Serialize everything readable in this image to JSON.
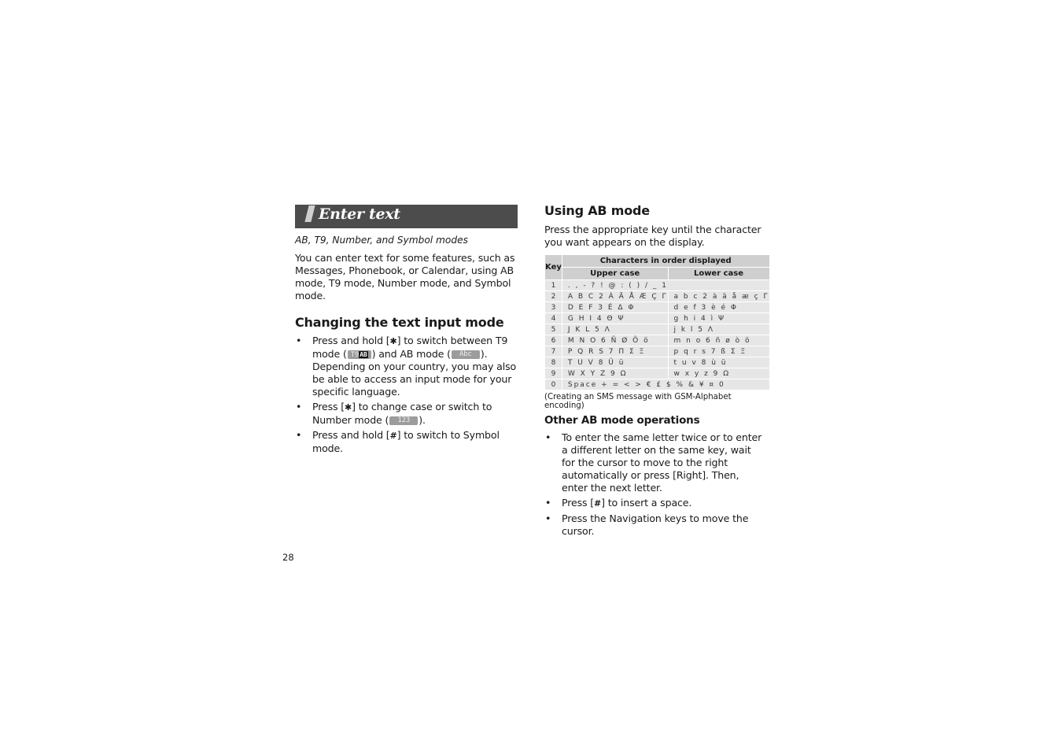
{
  "left": {
    "banner_title": "Enter text",
    "subtitle": "AB, T9, Number, and Symbol modes",
    "intro": "You can enter text for some features, such as Messages, Phonebook, or Calendar, using AB mode, T9 mode, Number mode, and Symbol mode.",
    "section_heading": "Changing the text input mode",
    "bullets": {
      "b1_part1": "Press and hold [",
      "b1_key": "✱",
      "b1_part2": "] to switch between T9 mode (",
      "b1_icon_t9": "T9",
      "b1_icon_t9_inv": "AB",
      "b1_part3": ") and AB mode (",
      "b1_icon_abc": "Abc",
      "b1_part4": "). Depending on your country, you may also be able to access an input mode for your specific language.",
      "b2_part1": "Press [",
      "b2_key": "✱",
      "b2_part2": "] to change case or switch to Number mode (",
      "b2_icon_123": "123",
      "b2_part3": ").",
      "b3_part1": "Press and hold [",
      "b3_key": "#",
      "b3_part2": "] to switch to Symbol mode."
    },
    "bullet_glyph": "•"
  },
  "right": {
    "heading": "Using AB mode",
    "intro": "Press the appropriate key until the character you want appears on the display.",
    "table": {
      "col_key": "Key",
      "col_group": "Characters in order displayed",
      "col_upper": "Upper case",
      "col_lower": "Lower case",
      "rows": [
        {
          "key": "1",
          "all": ". , - ? ! @ : ( ) / _ 1"
        },
        {
          "key": "2",
          "upper": "A B C 2 À Ä Å Æ Ç Γ",
          "lower": "a b c 2 à ä å æ ç Γ"
        },
        {
          "key": "3",
          "upper": "D E F 3 É Δ Φ",
          "lower": "d e f 3 è é Φ"
        },
        {
          "key": "4",
          "upper": "G H I 4 Θ Ψ",
          "lower": "g h i 4 ì Ψ"
        },
        {
          "key": "5",
          "upper": "J K L 5 Λ",
          "lower": "j k l 5 Λ"
        },
        {
          "key": "6",
          "upper": "M N O 6 Ñ Ø Ö ö",
          "lower": "m n o 6 ñ ø ò ö"
        },
        {
          "key": "7",
          "upper": "P Q R S 7 Π Σ Ξ",
          "lower": "p q r s 7 ß Σ Ξ"
        },
        {
          "key": "8",
          "upper": "T U V 8 Ü ü",
          "lower": "t u v 8 ù ü"
        },
        {
          "key": "9",
          "upper": "W X Y Z 9 Ω",
          "lower": "w x y z 9 Ω"
        },
        {
          "key": "0",
          "all": "Space + = < > € £ $ % & ¥ ¤ 0"
        }
      ]
    },
    "caption": "(Creating an SMS message with GSM-Alphabet encoding)",
    "sub_heading": "Other AB mode operations",
    "bullets": {
      "b1": "To enter the same letter twice or to enter a different letter on the same key, wait for the cursor to move to the right automatically or press [Right]. Then, enter the next letter.",
      "b2_part1": "Press [",
      "b2_key": "#",
      "b2_part2": "] to insert a space.",
      "b3": "Press the Navigation keys to move the cursor."
    },
    "bullet_glyph": "•"
  },
  "page_number": "28"
}
